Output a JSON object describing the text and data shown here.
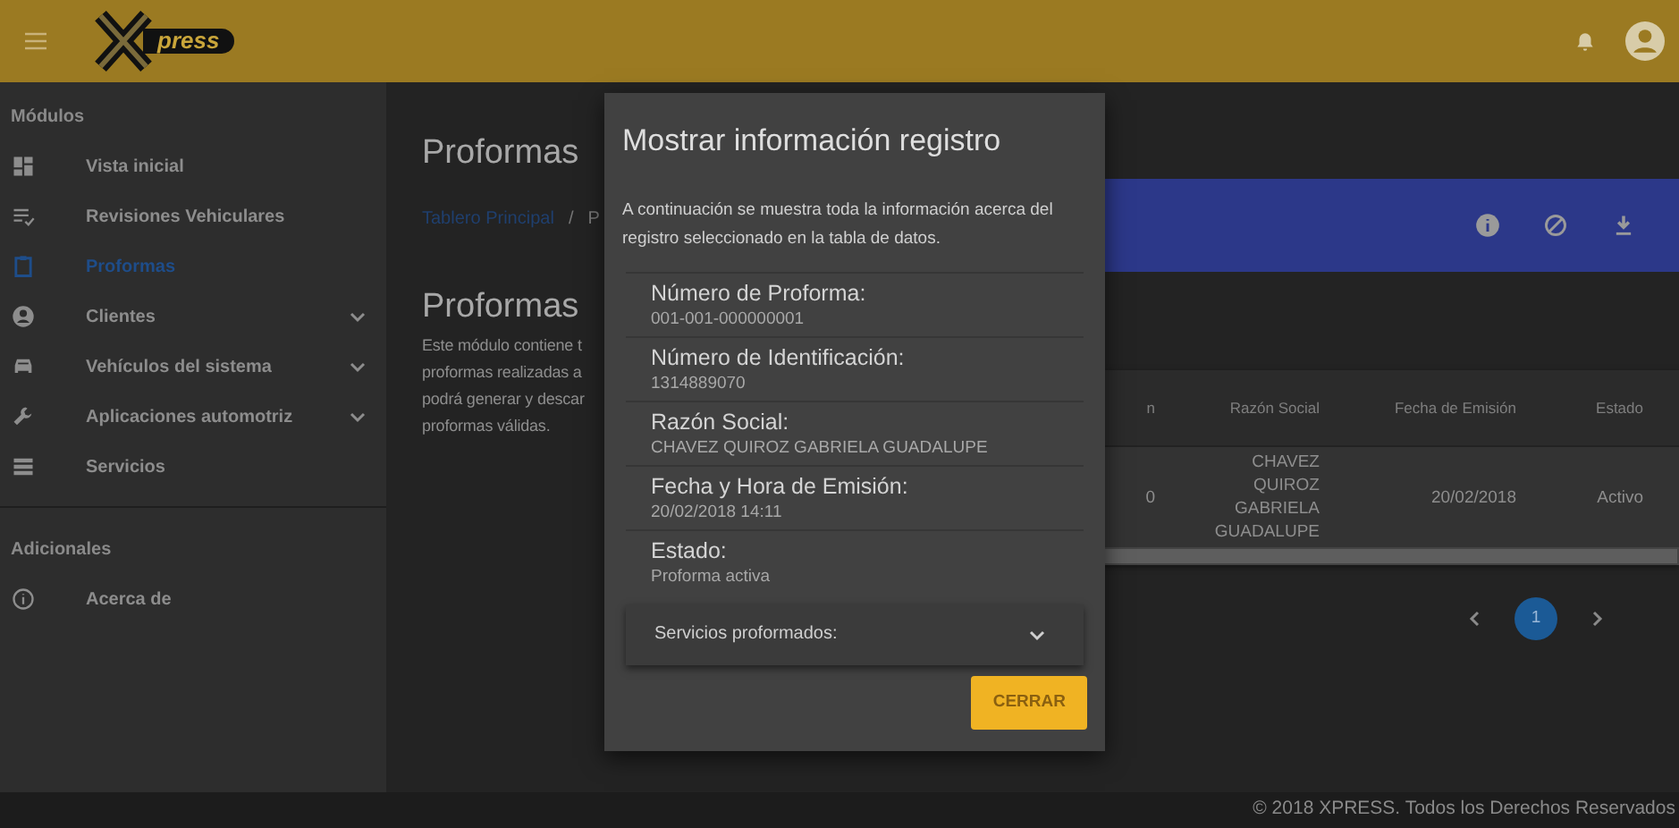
{
  "header": {
    "logo_text": "press"
  },
  "sidebar": {
    "sections": [
      {
        "title": "Módulos",
        "items": [
          {
            "label": "Vista inicial",
            "kind": "link",
            "selected": false
          },
          {
            "label": "Revisiones Vehiculares",
            "kind": "link",
            "selected": false
          },
          {
            "label": "Proformas",
            "kind": "link",
            "selected": true
          },
          {
            "label": "Clientes",
            "kind": "group",
            "selected": false
          },
          {
            "label": "Vehículos del sistema",
            "kind": "group",
            "selected": false
          },
          {
            "label": "Aplicaciones automotriz",
            "kind": "group",
            "selected": false
          },
          {
            "label": "Servicios",
            "kind": "link",
            "selected": false
          }
        ]
      },
      {
        "title": "Adicionales",
        "items": [
          {
            "label": "Acerca de",
            "kind": "link",
            "selected": false
          }
        ]
      }
    ]
  },
  "page": {
    "title": "Proformas",
    "breadcrumb": {
      "items": [
        "Tablero Principal",
        "P"
      ],
      "separator": "/"
    },
    "section_title": "Proformas",
    "description_lines": [
      "Este módulo contiene t",
      "proformas realizadas a",
      "podrá generar y descar",
      "proformas válidas."
    ]
  },
  "table": {
    "columns": [
      "n",
      "Razón Social",
      "Fecha de Emisión",
      "Estado"
    ],
    "rows": [
      [
        "0",
        "CHAVEZ QUIROZ GABRIELA GUADALUPE",
        "20/02/2018",
        "Activo"
      ]
    ]
  },
  "pagination": {
    "pages": [
      {
        "label": "1",
        "selected": true
      }
    ]
  },
  "modal": {
    "title": "Mostrar información registro",
    "intro": "A continuación se muestra toda la información acerca del registro seleccionado en la tabla de datos.",
    "fields": [
      {
        "label": "Número de Proforma:",
        "value": "001-001-000000001"
      },
      {
        "label": "Número de Identificación:",
        "value": "1314889070"
      },
      {
        "label": "Razón Social:",
        "value": "CHAVEZ QUIROZ GABRIELA GUADALUPE"
      },
      {
        "label": "Fecha y Hora de Emisión:",
        "value": "20/02/2018 14:11"
      },
      {
        "label": "Estado:",
        "value": "Proforma activa"
      }
    ],
    "expansion": {
      "label": "Servicios proformados:",
      "expanded": false
    },
    "button": "CERRAR"
  },
  "footer": "© 2018 XPRESS. Todos los Derechos Reservados"
}
